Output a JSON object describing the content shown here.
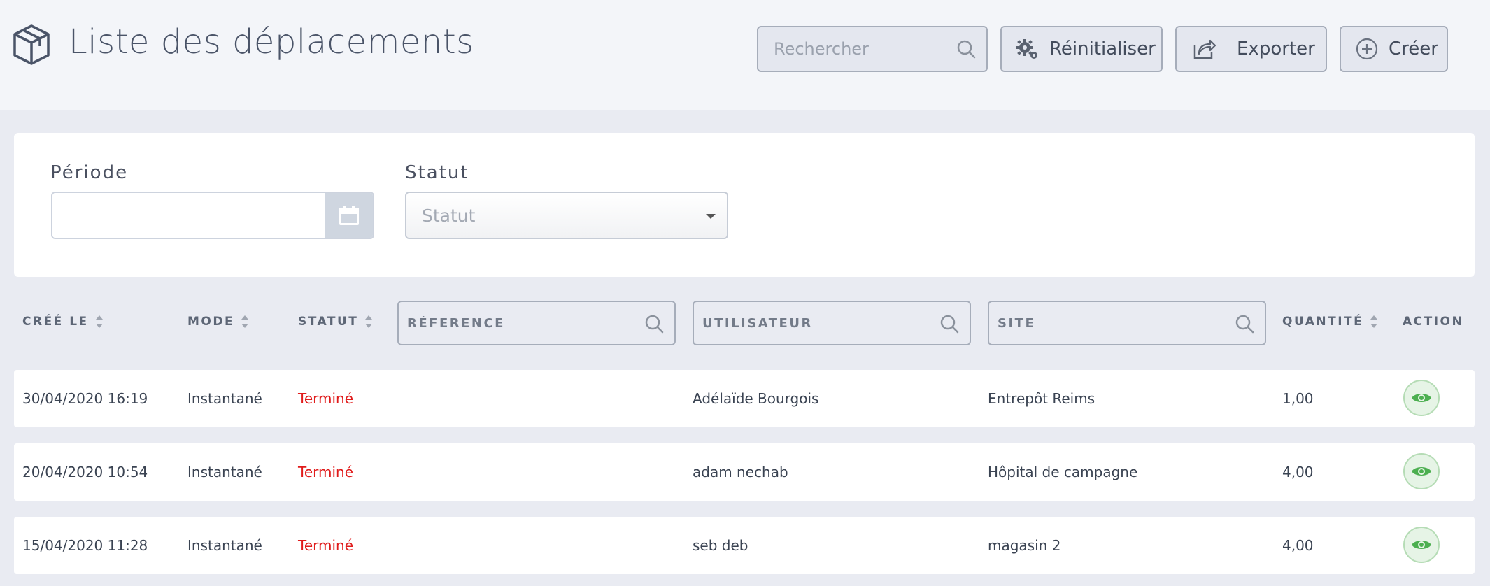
{
  "header": {
    "title": "Liste des déplacements",
    "search_placeholder": "Rechercher",
    "reset_label": "Réinitialiser",
    "export_label": "Exporter",
    "create_label": "Créer"
  },
  "filters": {
    "period_label": "Période",
    "period_value": "",
    "status_label": "Statut",
    "status_value": "Statut"
  },
  "table": {
    "columns": {
      "created": "CRÉÉ LE",
      "mode": "MODE",
      "status": "STATUT",
      "reference_placeholder": "RÉFERENCE",
      "user_placeholder": "UTILISATEUR",
      "site_placeholder": "SITE",
      "quantity": "QUANTITÉ",
      "action": "ACTION"
    },
    "rows": [
      {
        "created": "30/04/2020 16:19",
        "mode": "Instantané",
        "status": "Terminé",
        "reference": "",
        "user": "Adélaïde Bourgois",
        "site": "Entrepôt Reims",
        "quantity": "1,00"
      },
      {
        "created": "20/04/2020 10:54",
        "mode": "Instantané",
        "status": "Terminé",
        "reference": "",
        "user": "adam nechab",
        "site": "Hôpital de campagne",
        "quantity": "4,00"
      },
      {
        "created": "15/04/2020 11:28",
        "mode": "Instantané",
        "status": "Terminé",
        "reference": "",
        "user": "seb deb",
        "site": "magasin 2",
        "quantity": "4,00"
      }
    ]
  },
  "colors": {
    "status_done": "#e01b1b",
    "action_eye": "#4caf50",
    "background": "#e9ebf2"
  },
  "icons": {
    "title": "box-icon",
    "search": "search-icon",
    "reset": "gear-icon",
    "export": "share-icon",
    "create": "plus-circle-icon",
    "date": "calendar-icon",
    "action": "eye-icon"
  }
}
